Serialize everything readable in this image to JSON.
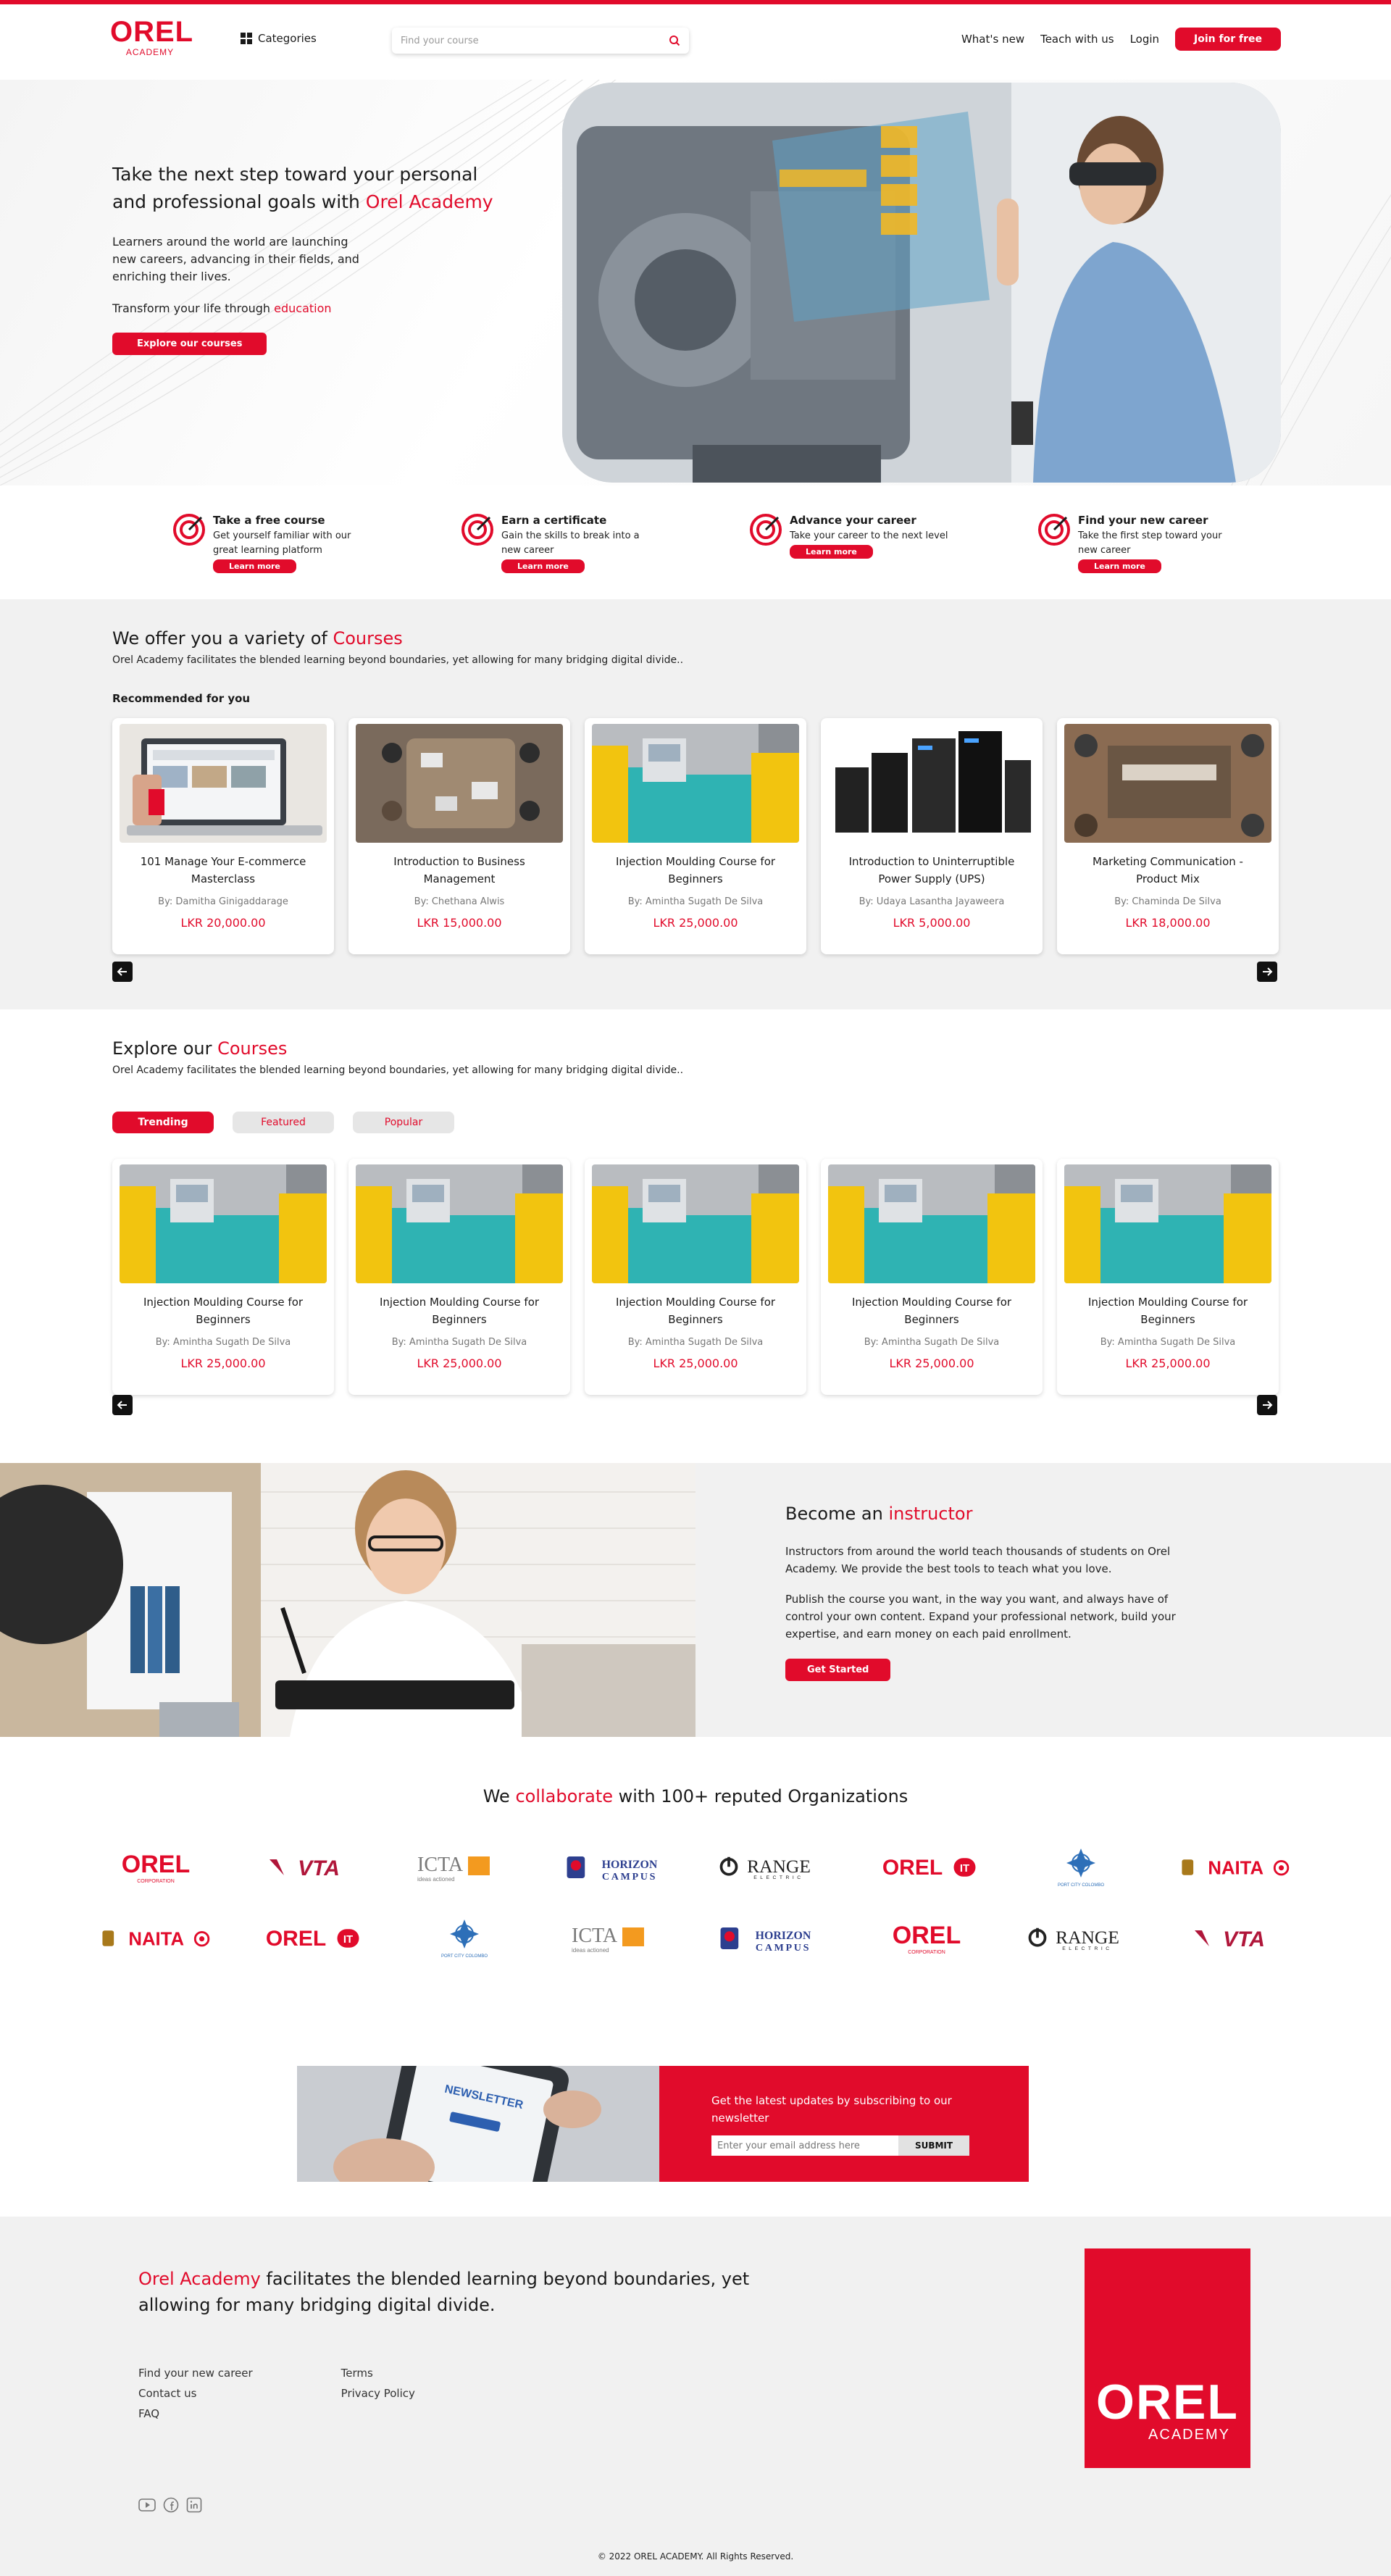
{
  "header": {
    "logo_text": "OREL",
    "logo_sub": "ACADEMY",
    "categories_label": "Categories",
    "search_placeholder": "Find your course",
    "nav": [
      "What's new",
      "Teach with us",
      "Login"
    ],
    "join_label": "Join for free"
  },
  "hero": {
    "title_line1": "Take the next step toward your personal",
    "title_line2_prefix": "and professional goals with ",
    "title_highlight": "Orel Academy",
    "description": "Learners around the world are launching new careers, advancing in their fields, and enriching their lives.",
    "transform_prefix": "Transform your life through ",
    "transform_highlight": "education",
    "cta": "Explore our courses"
  },
  "features": [
    {
      "title": "Take a free course",
      "desc": "Get yourself familiar with our great learning platform",
      "button": "Learn more"
    },
    {
      "title": "Earn a certificate",
      "desc": "Gain the skills to break into a new career",
      "button": "Learn more"
    },
    {
      "title": "Advance your career",
      "desc": "Take your career to the next level",
      "button": "Learn more"
    },
    {
      "title": "Find your new career",
      "desc": "Take the first step toward your new career",
      "button": "Learn more"
    }
  ],
  "offer": {
    "title_prefix": "We offer you a variety of ",
    "title_highlight": "Courses",
    "subtitle": "Orel Academy facilitates the blended learning beyond boundaries, yet allowing for many bridging digital divide..",
    "recommended_label": "Recommended for you",
    "courses": [
      {
        "title": "101 Manage Your E-commerce Masterclass",
        "author": "By: Damitha Ginigaddarage",
        "price": "LKR 20,000.00",
        "image": "laptop-ecommerce"
      },
      {
        "title": "Introduction to Business Management",
        "author": "By: Chethana Alwis",
        "price": "LKR 15,000.00",
        "image": "meeting-table"
      },
      {
        "title": "Injection Moulding Course for Beginners",
        "author": "By: Amintha Sugath De Silva",
        "price": "LKR 25,000.00",
        "image": "injection-machine"
      },
      {
        "title": "Introduction to Uninterruptible Power Supply (UPS)",
        "author": "By: Udaya Lasantha Jayaweera",
        "price": "LKR 5,000.00",
        "image": "ups-units"
      },
      {
        "title": "Marketing Communication - Product Mix",
        "author": "By: Chaminda De Silva",
        "price": "LKR 18,000.00",
        "image": "marketing-board"
      }
    ]
  },
  "explore": {
    "title_prefix": "Explore our ",
    "title_highlight": "Courses",
    "subtitle": "Orel Academy facilitates the blended learning beyond boundaries, yet allowing for many bridging digital divide..",
    "tabs": [
      "Trending",
      "Featured",
      "Popular"
    ],
    "active_tab": "Trending",
    "courses": [
      {
        "title": "Injection Moulding Course for Beginners",
        "author": "By: Amintha Sugath De Silva",
        "price": "LKR 25,000.00"
      },
      {
        "title": "Injection Moulding Course for Beginners",
        "author": "By: Amintha Sugath De Silva",
        "price": "LKR 25,000.00"
      },
      {
        "title": "Injection Moulding Course for Beginners",
        "author": "By: Amintha Sugath De Silva",
        "price": "LKR 25,000.00"
      },
      {
        "title": "Injection Moulding Course for Beginners",
        "author": "By: Amintha Sugath De Silva",
        "price": "LKR 25,000.00"
      },
      {
        "title": "Injection Moulding Course for Beginners",
        "author": "By: Amintha Sugath De Silva",
        "price": "LKR 25,000.00"
      }
    ]
  },
  "instructor": {
    "title_prefix": "Become an ",
    "title_highlight": "instructor",
    "p1": "Instructors from around the world teach thousands of students on Orel Academy. We provide the best tools  to teach what you love.",
    "p2": "Publish the course you want, in the way you want, and always have of control your own content. Expand your professional network, build your expertise, and earn money on each paid enrollment.",
    "cta": "Get Started"
  },
  "collab": {
    "title_prefix": "We ",
    "title_highlight": "collaborate",
    "title_suffix": " with 100+ reputed Organizations",
    "row1": [
      "OREL CORPORATION",
      "VTA",
      "ICTA",
      "HORIZON CAMPUS",
      "ORANGE ELECTRIC",
      "OREL IT",
      "PORT CITY COLOMBO",
      "NAITA"
    ],
    "row2": [
      "NAITA",
      "OREL IT",
      "PORT CITY COLOMBO",
      "ICTA",
      "HORIZON CAMPUS",
      "OREL CORPORATION",
      "ORANGE ELECTRIC",
      "VTA"
    ],
    "logo_text": {
      "orel": "OREL",
      "orel_corp_sub": "CORPORATION",
      "it": "IT",
      "vta": "VTA",
      "icta": "ICTA",
      "icta_sub": "ideas actioned",
      "horizon": "HORIZON",
      "campus": "CAMPUS",
      "orange": "RANGE",
      "electric": "ELECTRIC",
      "naita": "NAITA",
      "port_city": "PORT CITY COLOMBO"
    }
  },
  "newsletter": {
    "image_text": "NEWSLETTER",
    "text": "Get the latest updates by subscribing to our newsletter",
    "placeholder": "Enter your email address here",
    "submit": "SUBMIT"
  },
  "footer": {
    "title_highlight": "Orel Academy",
    "title_rest": " facilitates the blended learning beyond boundaries, yet allowing for many bridging digital divide.",
    "col1": [
      "Find your new career",
      "Contact us",
      "FAQ"
    ],
    "col2": [
      "Terms",
      "Privacy Policy"
    ],
    "logo_text": "OREL",
    "logo_sub": "ACADEMY",
    "copyright": "© 2022 OREL ACADEMY. All Rights Reserved."
  },
  "colors": {
    "accent": "#e10b2b",
    "grey_bg": "#f1f1f1"
  }
}
